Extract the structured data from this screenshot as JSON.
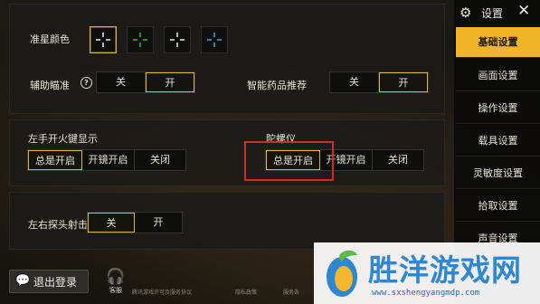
{
  "sections": {
    "crosshair": {
      "label": "准星颜色",
      "options": [
        {
          "color": "#ffffff",
          "selected": true
        },
        {
          "color": "#2fc24c",
          "selected": false
        },
        {
          "color": "#ffffff",
          "selected": false
        },
        {
          "color": "#3fb9e8",
          "selected": false
        }
      ]
    },
    "aim_assist": {
      "label": "辅助瞄准",
      "off": "关",
      "on": "开",
      "value": "开"
    },
    "smart_medicine": {
      "label": "智能药品推荐",
      "off": "关",
      "on": "开",
      "value": "开"
    },
    "left_fire": {
      "label": "左手开火键显示",
      "options": [
        "总是开启",
        "开镜开启",
        "关闭"
      ],
      "value": "总是开启"
    },
    "gyroscope": {
      "label": "陀螺仪",
      "options": [
        "总是开启",
        "开镜开启",
        "关闭"
      ],
      "value": "总是开启"
    },
    "peek_fire": {
      "label": "左右探头射击",
      "off": "关",
      "on": "开",
      "value": "关"
    }
  },
  "sidebar": {
    "title": "设置",
    "items": [
      {
        "label": "基础设置",
        "active": true
      },
      {
        "label": "画面设置",
        "active": false
      },
      {
        "label": "操作设置",
        "active": false
      },
      {
        "label": "载具设置",
        "active": false
      },
      {
        "label": "灵敏度设置",
        "active": false
      },
      {
        "label": "拾取设置",
        "active": false
      },
      {
        "label": "声音设置",
        "active": false
      }
    ]
  },
  "bottom": {
    "logout": "退出登录",
    "customer_service": "客服",
    "links": [
      "腾讯游戏许可及服务协议",
      "隐私政策",
      "服务条"
    ]
  },
  "watermark": {
    "title": "胜洋游戏网",
    "url": "www.sxshengyangmdp.com"
  },
  "colors": {
    "accent": "#f2b52a",
    "selected_border": "#d8b24a",
    "highlight_red": "#d82a1c",
    "watermark_blue": "#2f86d1"
  }
}
